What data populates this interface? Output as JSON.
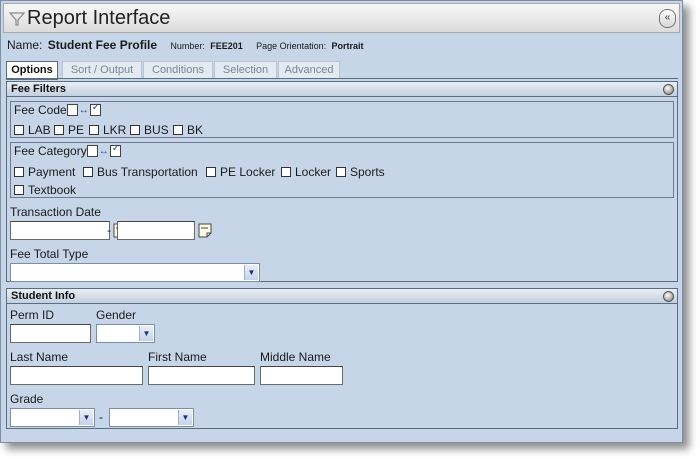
{
  "window": {
    "title": "Report Interface",
    "collapse_glyph": "«"
  },
  "profile": {
    "name_label": "Name:",
    "name_value": "Student Fee Profile",
    "number_label": "Number:",
    "number_value": "FEE201",
    "orientation_label": "Page Orientation:",
    "orientation_value": "Portrait"
  },
  "tabs": [
    {
      "label": "Options",
      "active": true
    },
    {
      "label": "Sort / Output"
    },
    {
      "label": "Conditions"
    },
    {
      "label": "Selection"
    },
    {
      "label": "Advanced"
    }
  ],
  "fee_filters": {
    "title": "Fee Filters",
    "fee_code": {
      "label": "Fee Code",
      "options": [
        "LAB",
        "PE",
        "LKR",
        "BUS",
        "BK"
      ]
    },
    "fee_category": {
      "label": "Fee Category",
      "options": [
        "Payment",
        "Bus Transportation",
        "PE Locker",
        "Locker",
        "Sports",
        "Textbook"
      ]
    },
    "transaction_date": {
      "label": "Transaction Date",
      "from": "",
      "to": "",
      "separator": "-"
    },
    "fee_total_type": {
      "label": "Fee Total Type",
      "value": ""
    }
  },
  "student_info": {
    "title": "Student Info",
    "perm_id": {
      "label": "Perm ID",
      "value": ""
    },
    "gender": {
      "label": "Gender",
      "value": ""
    },
    "last_name": {
      "label": "Last Name",
      "value": ""
    },
    "first_name": {
      "label": "First Name",
      "value": ""
    },
    "middle_name": {
      "label": "Middle Name",
      "value": ""
    },
    "grade": {
      "label": "Grade",
      "from": "",
      "to": "",
      "separator": "-"
    }
  },
  "icons": {
    "title": "funnel-icon",
    "group_toggle": "select-all-toggle-icon",
    "section": "collapse-circle-icon",
    "calendar": "calendar-icon",
    "dropdown": "chevron-down-icon"
  },
  "colors": {
    "panel_bg": "#c6d6e8",
    "border": "#5d6d80",
    "accent_arrow": "#1d2f6f"
  }
}
